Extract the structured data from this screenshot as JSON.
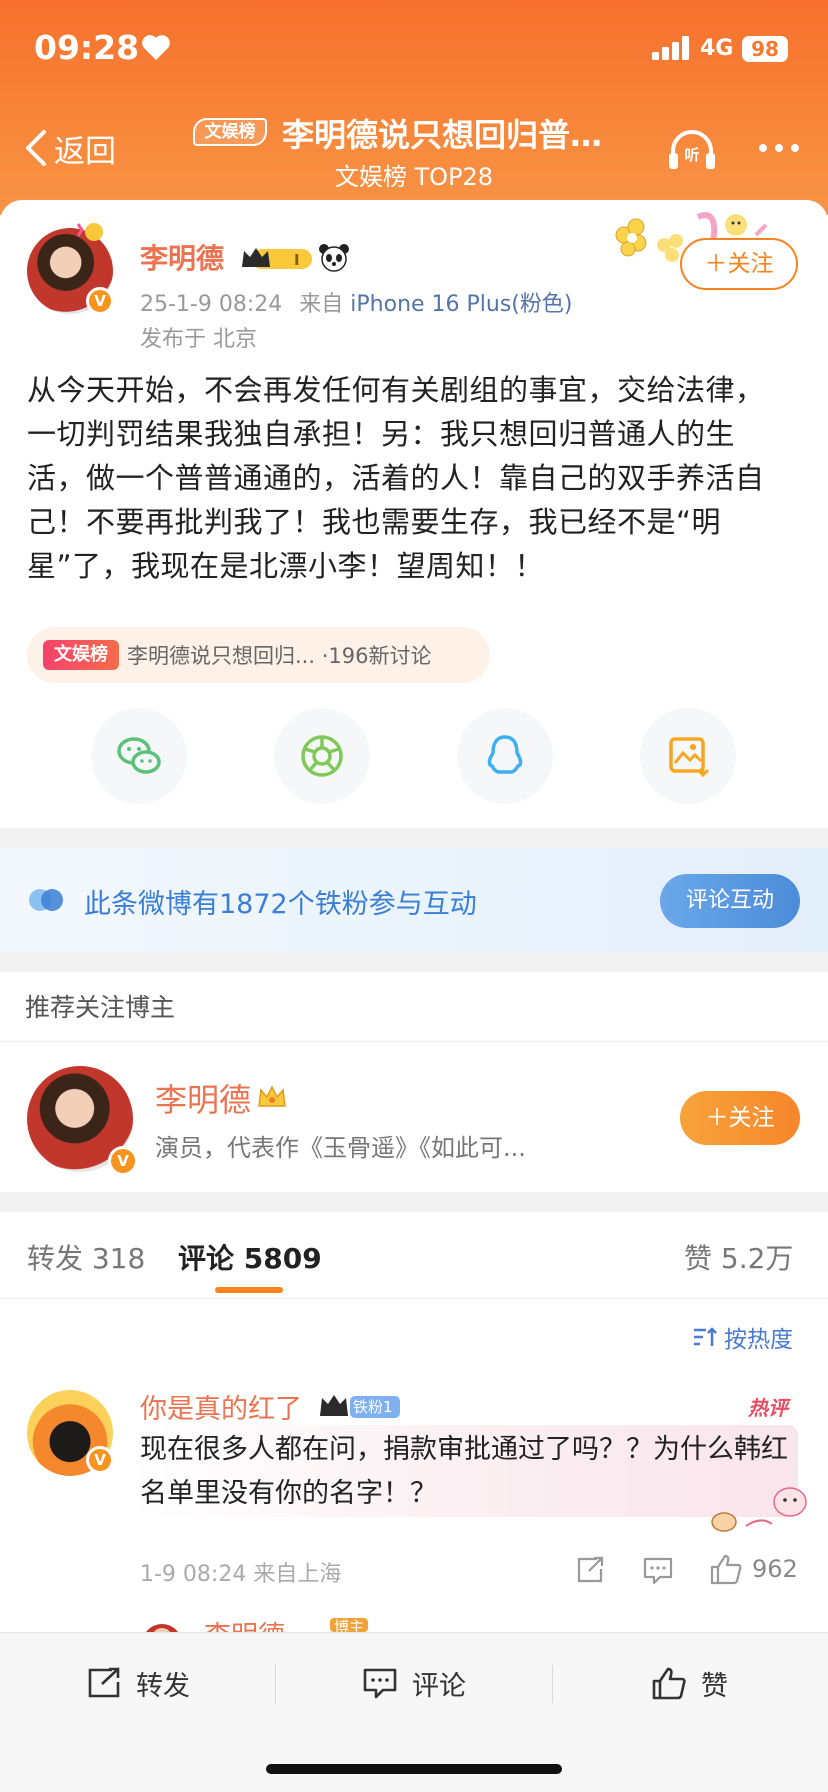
{
  "status_bar": {
    "time": "09:28",
    "network": "4G",
    "battery": "98"
  },
  "nav": {
    "back_label": "返回",
    "topic_badge": "文娱榜",
    "title": "李明德说只想回归普…",
    "subtitle": "文娱榜 TOP28"
  },
  "post": {
    "author": "李明德",
    "verified_mark": "V",
    "date": "25-1-9 08:24",
    "from_prefix": "来自",
    "device": "iPhone 16 Plus(粉色)",
    "location": "发布于 北京",
    "follow_label": "＋关注",
    "text": "从今天开始，不会再发任何有关剧组的事宜，交给法律，一切判罚结果我独自承担！另：我只想回归普通人的生活，做一个普普通通的，活着的人！靠自己的双手养活自己！不要再批判我了！我也需要生存，我已经不是“明星”了，我现在是北漂小李！望周知！！",
    "topic_chip": {
      "tag": "文娱榜",
      "text": "李明德说只想回归... ·196新讨论"
    },
    "share_icons": [
      "wechat-icon",
      "moments-icon",
      "qq-icon",
      "save-image-icon"
    ]
  },
  "fans_banner": {
    "text": "此条微博有1872个铁粉参与互动",
    "button": "评论互动"
  },
  "recommend": {
    "section_title": "推荐关注博主",
    "name": "李明德",
    "desc": "演员，代表作《玉骨遥》《如此可...",
    "follow_label": "＋关注"
  },
  "tabs": {
    "repost": "转发 318",
    "comment": "评论 5809",
    "likes": "赞 5.2万"
  },
  "sort_label": "按热度",
  "comment": {
    "name": "你是真的红了",
    "fan_badge": "铁粉1",
    "hot_label": "热评",
    "text": "现在很多人都在问，捐款审批通过了吗？？为什么韩红名单里没有你的名字！？",
    "time_loc": "1-9 08:24 来自上海",
    "like_count": "962",
    "reply_peek_name": "李明德",
    "reply_peek_badge": "博主"
  },
  "bottom_bar": {
    "repost": "转发",
    "comment": "评论",
    "like": "赞"
  },
  "colors": {
    "header_orange": "#f7782f",
    "name_orange": "#eb7350",
    "link_blue": "#5475a8",
    "banner_blue": "#3a7fd5"
  }
}
